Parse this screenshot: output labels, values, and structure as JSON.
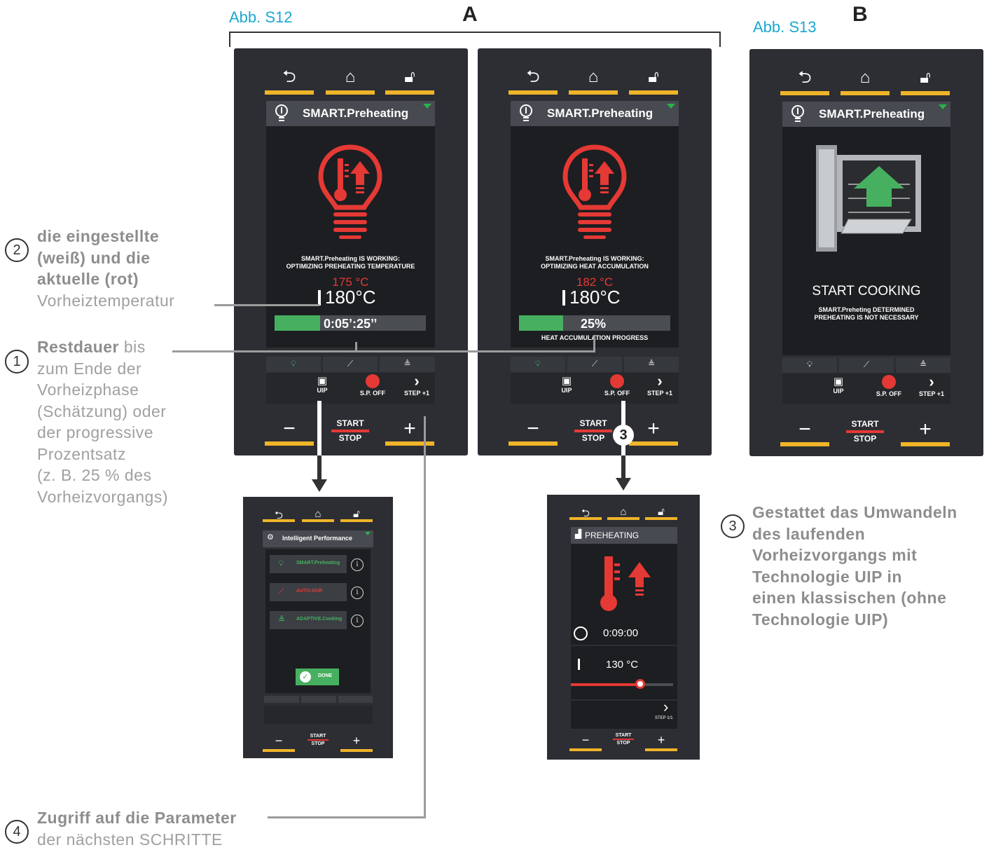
{
  "figure": {
    "label_s12": "Abb. S12",
    "label_s13": "Abb. S13",
    "letter_a": "A",
    "letter_b": "B"
  },
  "panel_a1": {
    "header": "SMART.Preheating",
    "msg_line1": "SMART.Preheating IS WORKING:",
    "msg_line2": "OPTIMIZING PREHEATING TEMPERATURE",
    "actual_temp": "175 °C",
    "set_temp": "180°C",
    "progress_text": "0:05’:25’’",
    "progress_fraction": 0.3,
    "uip": "UIP",
    "sp_off": "S.P. OFF",
    "step": "STEP +1",
    "start": "START",
    "stop": "STOP"
  },
  "panel_a2": {
    "header": "SMART.Preheating",
    "msg_line1": "SMART.Preheating IS WORKING:",
    "msg_line2": "OPTIMIZING HEAT ACCUMULATION",
    "actual_temp": "182 °C",
    "set_temp": "180°C",
    "progress_text": "25%",
    "progress_fraction": 0.29,
    "progress_caption": "HEAT ACCUMULATION PROGRESS",
    "uip": "UIP",
    "sp_off": "S.P. OFF",
    "step": "STEP +1",
    "start": "START",
    "stop": "STOP",
    "badge": "3"
  },
  "panel_b": {
    "header": "SMART.Preheating",
    "title": "START COOKING",
    "msg_line1": "SMART.Preheting DETERMINED",
    "msg_line2": "PREHEATING IS NOT NECESSARY",
    "uip": "UIP",
    "sp_off": "S.P. OFF",
    "step": "STEP +1",
    "start": "START",
    "stop": "STOP"
  },
  "panel_ip": {
    "header": "Intelligent Performance",
    "items": [
      {
        "label": "SMART.Preheating",
        "color": "#46b060"
      },
      {
        "label": "AUTO.Shift",
        "color": "#e53935"
      },
      {
        "label": "ADAPTIVE.Cooking",
        "color": "#46b060"
      }
    ],
    "done": "DONE",
    "start": "START",
    "stop": "STOP"
  },
  "panel_pre": {
    "header": "PREHEATING",
    "time": "0:09:00",
    "temp": "130 °C",
    "slider_fraction": 0.68,
    "step": "STEP 1/1",
    "start": "START",
    "stop": "STOP"
  },
  "annotations": {
    "a2": {
      "num": "2",
      "bold1": "die eingestellte",
      "bold2": "(weiß) und die",
      "bold3": "aktuelle (rot)",
      "rest": "Vorheiztemperatur"
    },
    "a1": {
      "num": "1",
      "bold": "Restdauer",
      "l1": " bis",
      "l2": "zum Ende der",
      "l3": "Vorheizphase",
      "l4": "(Schätzung) oder",
      "l5": "der progressive",
      "l6": "Prozentsatz",
      "l7": "(z. B. 25 % des",
      "l8": "Vorheizvorgangs)"
    },
    "a3": {
      "num": "3",
      "l1": "Gestattet das Umwandeln",
      "l2": "des laufenden",
      "l3": "Vorheizvorgangs mit",
      "l4": "Technologie UIP in",
      "l5": "einen klassischen (ohne",
      "l6": "Technologie UIP)"
    },
    "a4": {
      "num": "4",
      "bold": "Zugriff auf die Parameter",
      "rest": "der nächsten SCHRITTE"
    }
  },
  "colors": {
    "accent_yellow": "#f0b429",
    "red": "#e53935",
    "green": "#46b060",
    "panel": "#2c2e33",
    "figure_label": "#1aa7cf"
  }
}
